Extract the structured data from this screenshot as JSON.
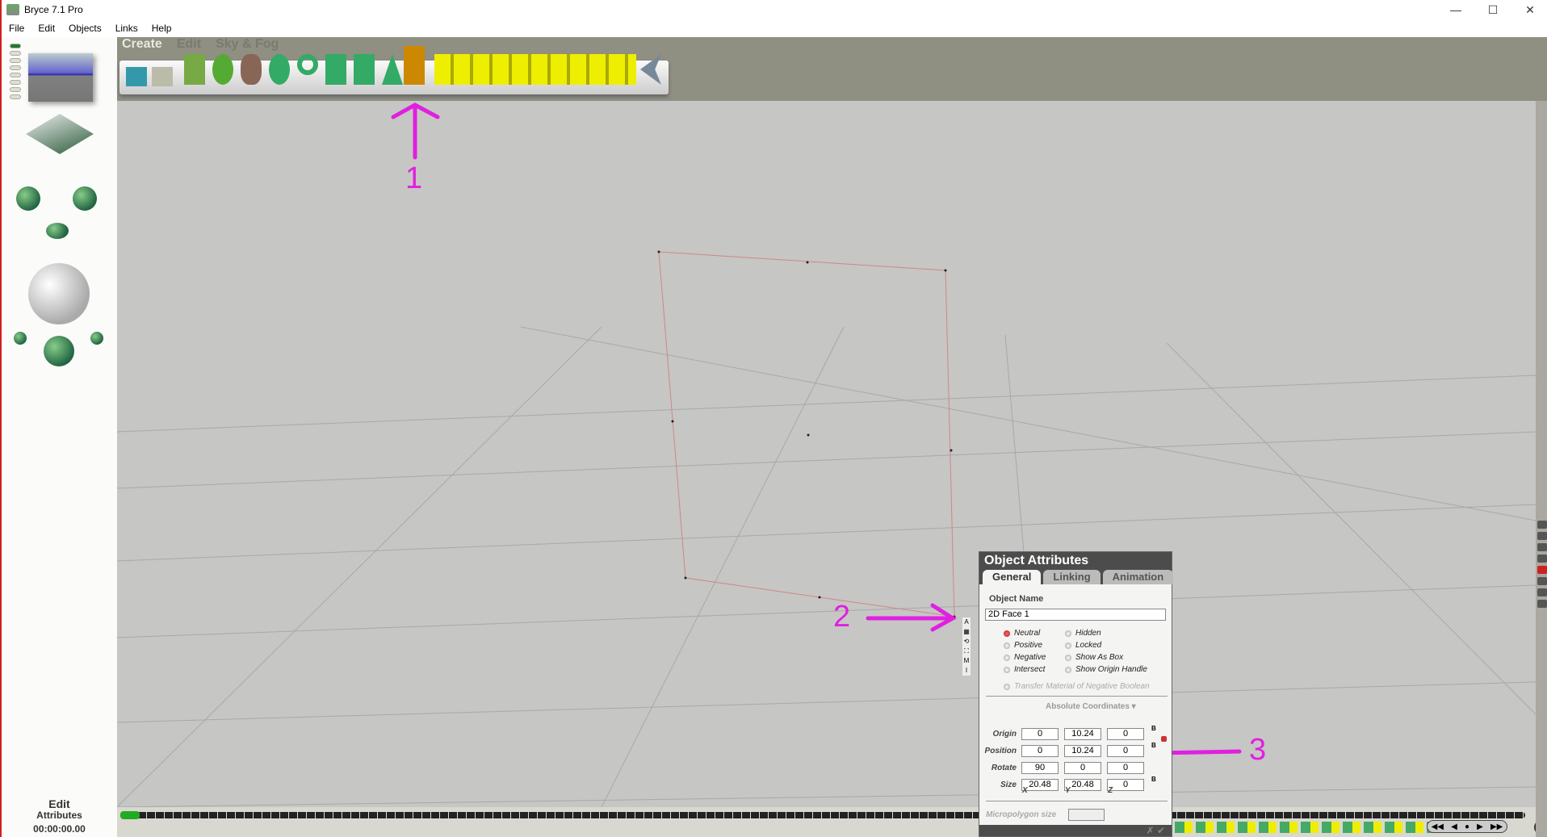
{
  "window": {
    "title": "Bryce 7.1  Pro",
    "minimize": "—",
    "maximize": "☐",
    "close": "✕"
  },
  "menu": [
    "File",
    "Edit",
    "Objects",
    "Links",
    "Help"
  ],
  "palette_tabs": [
    "Create",
    "Edit",
    "Sky & Fog"
  ],
  "left_panel": {
    "mode": "Edit",
    "sub": "Attributes",
    "time": "00:00:00.00"
  },
  "object_attributes": {
    "title": "Object Attributes",
    "tabs": [
      "General",
      "Linking",
      "Animation"
    ],
    "object_name_label": "Object Name",
    "object_name": "2D Face 1",
    "boolean_options": [
      "Neutral",
      "Positive",
      "Negative",
      "Intersect"
    ],
    "selected_boolean": "Neutral",
    "flags": [
      "Hidden",
      "Locked",
      "Show As Box",
      "Show Origin Handle"
    ],
    "transfer": "Transfer Material of Negative Boolean",
    "coord_mode": "Absolute Coordinates",
    "rows": [
      {
        "label": "Origin",
        "x": "0",
        "y": "10.24",
        "z": "0"
      },
      {
        "label": "Position",
        "x": "0",
        "y": "10.24",
        "z": "0"
      },
      {
        "label": "Rotate",
        "x": "90",
        "y": "0",
        "z": "0"
      },
      {
        "label": "Size",
        "x": "20.48",
        "y": "20.48",
        "z": "0"
      }
    ],
    "axes": [
      "X",
      "Y",
      "Z"
    ],
    "b_marker": "B",
    "micropolygon_label": "Micropolygon size",
    "cancel": "✗",
    "ok": "✔"
  },
  "object_tags": [
    "A",
    "▦",
    "⟲",
    "⛶",
    "M",
    "I"
  ],
  "annotations": [
    "1",
    "2",
    "3"
  ],
  "accent": "#e020e0"
}
